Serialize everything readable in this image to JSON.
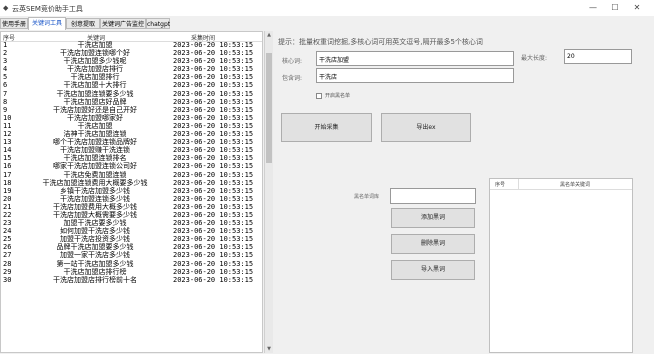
{
  "window": {
    "title": "云英SEM竞价助手工具",
    "minimize": "—",
    "maximize": "☐",
    "close": "✕"
  },
  "tabs": [
    {
      "label": "使用手册"
    },
    {
      "label": "关键词工具"
    },
    {
      "label": "创意提取"
    },
    {
      "label": "关键词广告监控"
    },
    {
      "label": "chatgpt"
    }
  ],
  "list": {
    "headers": {
      "no": "序号",
      "keyword": "关键词",
      "time": "采集时间"
    },
    "rows": [
      {
        "no": "1",
        "kw": "干洗店加盟",
        "t": "2023-06-20 10:53:15"
      },
      {
        "no": "2",
        "kw": "干洗店加盟连锁哪个好",
        "t": "2023-06-20 10:53:15"
      },
      {
        "no": "3",
        "kw": "干洗店加盟多少钱呢",
        "t": "2023-06-20 10:53:15"
      },
      {
        "no": "4",
        "kw": "干洗店加盟店排行",
        "t": "2023-06-20 10:53:15"
      },
      {
        "no": "5",
        "kw": "干洗店加盟排行",
        "t": "2023-06-20 10:53:15"
      },
      {
        "no": "6",
        "kw": "干洗店加盟十大排行",
        "t": "2023-06-20 10:53:15"
      },
      {
        "no": "7",
        "kw": "干洗店加盟连锁要多少钱",
        "t": "2023-06-20 10:53:15"
      },
      {
        "no": "8",
        "kw": "干洗店加盟店好品牌",
        "t": "2023-06-20 10:53:15"
      },
      {
        "no": "9",
        "kw": "干洗店加盟好还是自己开好",
        "t": "2023-06-20 10:53:15"
      },
      {
        "no": "10",
        "kw": "干洗店加盟哪家好",
        "t": "2023-06-20 10:53:15"
      },
      {
        "no": "11",
        "kw": "干洗店加盟",
        "t": "2023-06-20 10:53:15"
      },
      {
        "no": "12",
        "kw": "洁神干洗店加盟连锁",
        "t": "2023-06-20 10:53:15"
      },
      {
        "no": "13",
        "kw": "哪个干洗店加盟连锁品牌好",
        "t": "2023-06-20 10:53:15"
      },
      {
        "no": "14",
        "kw": "干洗店加盟赚干洗连锁",
        "t": "2023-06-20 10:53:15"
      },
      {
        "no": "15",
        "kw": "干洗店加盟连锁排名",
        "t": "2023-06-20 10:53:15"
      },
      {
        "no": "16",
        "kw": "哪家干洗店加盟连锁公司好",
        "t": "2023-06-20 10:53:15"
      },
      {
        "no": "17",
        "kw": "干洗店免费加盟连锁",
        "t": "2023-06-20 10:53:15"
      },
      {
        "no": "18",
        "kw": "干洗店加盟连锁费用大概要多少钱",
        "t": "2023-06-20 10:53:15"
      },
      {
        "no": "19",
        "kw": "乡镇干洗店加盟多少钱",
        "t": "2023-06-20 10:53:15"
      },
      {
        "no": "20",
        "kw": "干洗店加盟连锁多少钱",
        "t": "2023-06-20 10:53:15"
      },
      {
        "no": "21",
        "kw": "干洗店加盟费用大概多少钱",
        "t": "2023-06-20 10:53:15"
      },
      {
        "no": "22",
        "kw": "干洗店加盟大概需要多少钱",
        "t": "2023-06-20 10:53:15"
      },
      {
        "no": "23",
        "kw": "加盟干洗店要多少钱",
        "t": "2023-06-20 10:53:15"
      },
      {
        "no": "24",
        "kw": "如何加盟干洗店多少钱",
        "t": "2023-06-20 10:53:15"
      },
      {
        "no": "25",
        "kw": "加盟干洗店投资多少钱",
        "t": "2023-06-20 10:53:15"
      },
      {
        "no": "26",
        "kw": "品牌干洗店加盟要多少钱",
        "t": "2023-06-20 10:53:15"
      },
      {
        "no": "27",
        "kw": "加盟一家干洗店多少钱",
        "t": "2023-06-20 10:53:15"
      },
      {
        "no": "28",
        "kw": "第一站干洗店加盟多少钱",
        "t": "2023-06-20 10:53:15"
      },
      {
        "no": "29",
        "kw": "干洗店加盟店排行榜",
        "t": "2023-06-20 10:53:15"
      },
      {
        "no": "30",
        "kw": "干洗店加盟店排行榜前十名",
        "t": "2023-06-20 10:53:15"
      }
    ]
  },
  "tool": {
    "prompt": "提示：批量权重词挖掘,多核心词可用英文逗号,隔开最多5个核心词",
    "core_label": "核心词:",
    "core_value": "干洗店加盟",
    "maxlen_label": "最大长度:",
    "maxlen_value": "20",
    "include_label": "包含词:",
    "include_value": "干洗店",
    "filter_label": "开启黑名单",
    "start_btn": "开始采集",
    "export_btn": "导出ex",
    "blacklist_label": "黑名单词库",
    "blacklist_value": "",
    "add_btn": "添加黑词",
    "delete_btn": "删除黑词",
    "import_btn": "导入黑词"
  },
  "blacklist_grid": {
    "headers": {
      "no": "序号",
      "keyword": "黑名单关键词"
    }
  }
}
